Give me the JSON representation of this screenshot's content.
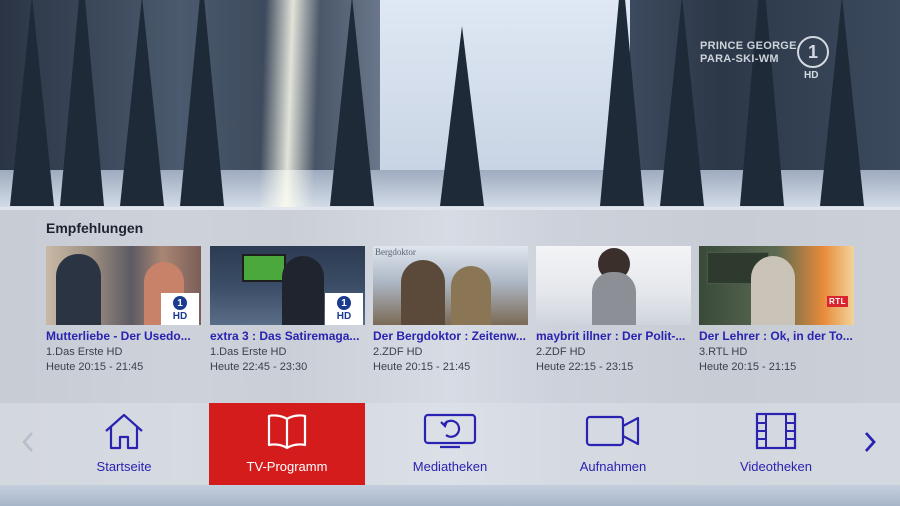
{
  "channel_logo": {
    "event_line1": "PRINCE GEORGE",
    "event_line2": "PARA-SKI-WM",
    "ard": "1",
    "hd": "HD"
  },
  "recommendations": {
    "heading": "Empfehlungen",
    "items": [
      {
        "title": "Mutterliebe - Der Usedo...",
        "channel": "1.Das Erste HD",
        "time": "Heute 20:15 - 21:45",
        "badge": "ard-hd"
      },
      {
        "title": "extra 3 : Das Satiremaga...",
        "channel": "1.Das Erste HD",
        "time": "Heute 22:45 - 23:30",
        "badge": "ard-hd"
      },
      {
        "title": "Der Bergdoktor : Zeitenw...",
        "channel": "2.ZDF HD",
        "time": "Heute 20:15 - 21:45",
        "badge": ""
      },
      {
        "title": "maybrit illner : Der Polit-...",
        "channel": "2.ZDF HD",
        "time": "Heute 22:15 - 23:15",
        "badge": ""
      },
      {
        "title": "Der Lehrer : Ok, in der To...",
        "channel": "3.RTL HD",
        "time": "Heute 20:15 - 21:15",
        "badge": "rtl"
      }
    ],
    "badge_one": "1",
    "badge_hd": "HD",
    "thumb_overlay_text": "Bergdoktor"
  },
  "nav": {
    "items": [
      {
        "label": "Startseite",
        "icon": "home-icon",
        "active": false
      },
      {
        "label": "TV-Programm",
        "icon": "book-icon",
        "active": true
      },
      {
        "label": "Mediatheken",
        "icon": "replay-screen-icon",
        "active": false
      },
      {
        "label": "Aufnahmen",
        "icon": "video-camera-icon",
        "active": false
      },
      {
        "label": "Videotheken",
        "icon": "film-strip-icon",
        "active": false
      }
    ]
  },
  "colors": {
    "accent": "#2a22b0",
    "active_bg": "#d51c1c",
    "panel_bg": "#e2e5ec"
  }
}
